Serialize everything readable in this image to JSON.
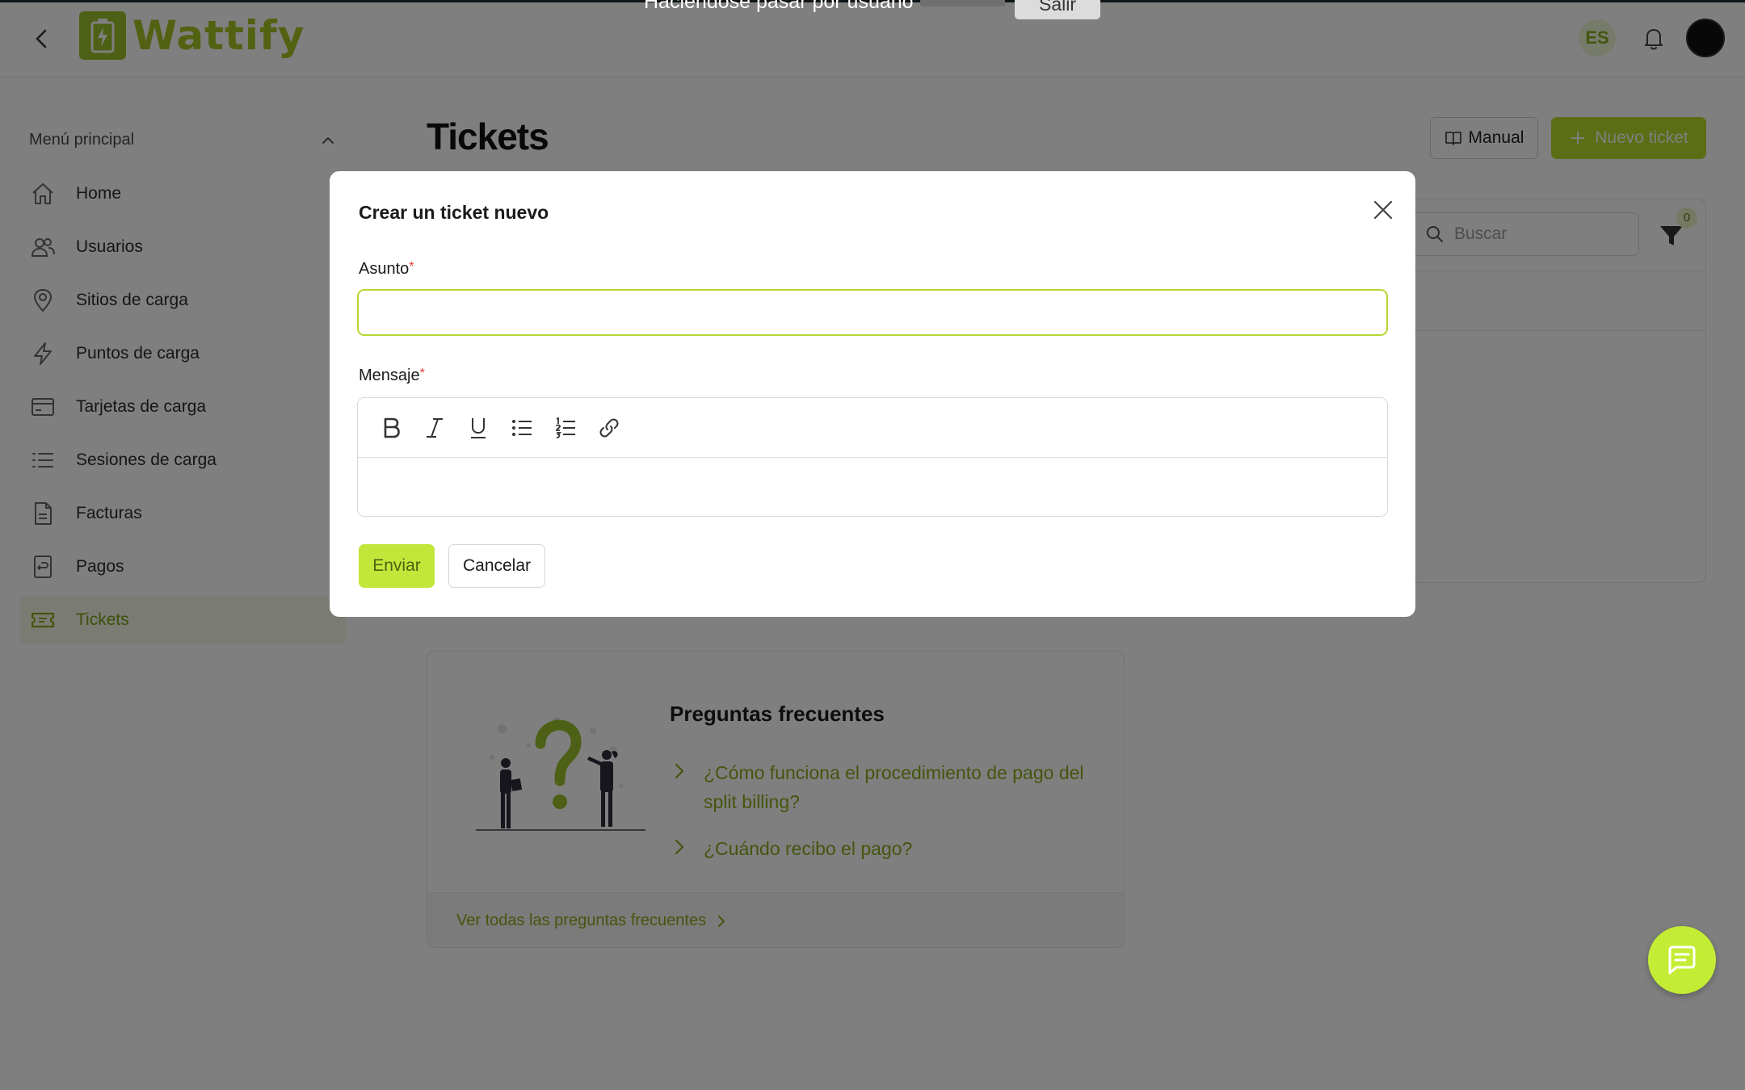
{
  "impersonation": {
    "text": "Haciéndose pasar por usuario",
    "exit_label": "Salir"
  },
  "header": {
    "brand": "Wattify",
    "language": "ES"
  },
  "sidebar": {
    "menu_title": "Menú principal",
    "items": [
      {
        "label": "Home",
        "icon": "home-icon"
      },
      {
        "label": "Usuarios",
        "icon": "users-icon"
      },
      {
        "label": "Sitios de carga",
        "icon": "location-pin-icon"
      },
      {
        "label": "Puntos de carga",
        "icon": "lightning-icon"
      },
      {
        "label": "Tarjetas de carga",
        "icon": "card-icon"
      },
      {
        "label": "Sesiones de carga",
        "icon": "list-icon"
      },
      {
        "label": "Facturas",
        "icon": "document-icon"
      },
      {
        "label": "Pagos",
        "icon": "receipt-icon"
      },
      {
        "label": "Tickets",
        "icon": "ticket-icon",
        "active": true
      }
    ]
  },
  "main": {
    "title": "Tickets",
    "manual_label": "Manual",
    "new_ticket_label": "Nuevo ticket",
    "search_placeholder": "Buscar",
    "filter_count": "0"
  },
  "faq": {
    "title": "Preguntas frecuentes",
    "questions": [
      "¿Cómo funciona el procedimiento de pago del split billing?",
      "¿Cuándo recibo el pago?"
    ],
    "see_all_label": "Ver todas las preguntas frecuentes"
  },
  "modal": {
    "title": "Crear un ticket nuevo",
    "subject_label": "Asunto",
    "subject_value": "",
    "message_label": "Mensaje",
    "message_value": "",
    "required_mark": "*",
    "toolbar": [
      "bold-icon",
      "italic-icon",
      "underline-icon",
      "bullet-list-icon",
      "numbered-list-icon",
      "link-icon"
    ],
    "send_label": "Enviar",
    "cancel_label": "Cancelar"
  },
  "colors": {
    "accent": "#b8dc2a",
    "accent_text": "#8aab1c",
    "required": "#e53935"
  }
}
